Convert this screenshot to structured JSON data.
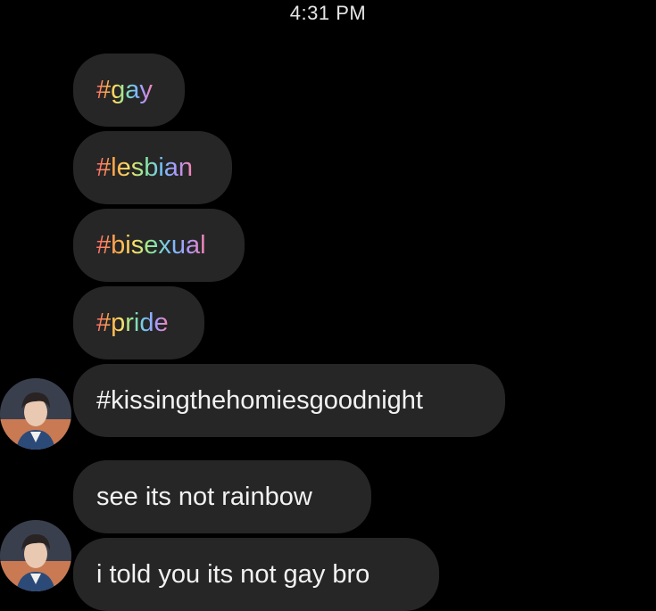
{
  "thread": {
    "timestamp": "4:31 PM",
    "messages": [
      {
        "text": "#gay",
        "style": "rainbow-hashtag"
      },
      {
        "text": "#lesbian",
        "style": "rainbow-hashtag"
      },
      {
        "text": "#bisexual",
        "style": "rainbow-hashtag"
      },
      {
        "text": "#pride",
        "style": "rainbow-hashtag"
      },
      {
        "text": "#kissingthehomiesgoodnight",
        "style": "plain"
      },
      {
        "text": "see its not rainbow",
        "style": "plain"
      },
      {
        "text": "i told you its not gay bro",
        "style": "plain"
      }
    ]
  },
  "colors": {
    "background": "#000000",
    "bubble": "#262626",
    "text": "#f2f2f2",
    "timestamp": "#e6e6e6"
  }
}
